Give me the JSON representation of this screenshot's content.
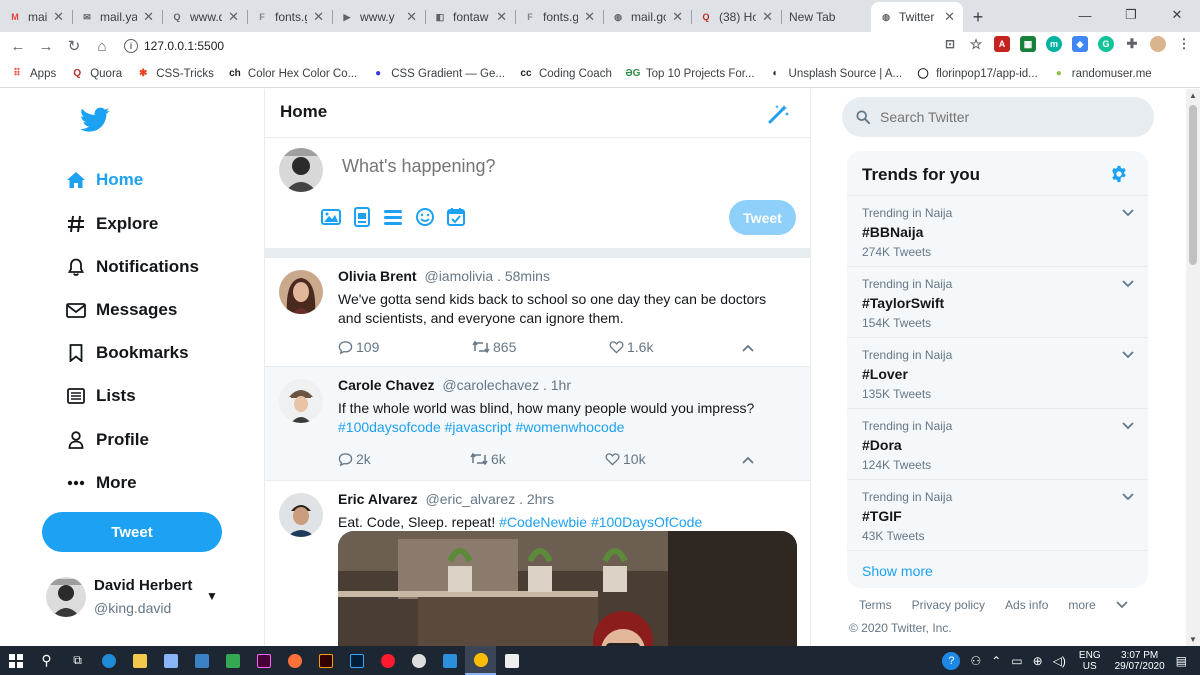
{
  "browser": {
    "tabs": [
      {
        "title": "mail.go",
        "icon": "gmail-icon",
        "color": "#ea4335",
        "glyph": "M"
      },
      {
        "title": "mail.ya",
        "icon": "mail-icon",
        "color": "#5f6368",
        "glyph": "✉"
      },
      {
        "title": "www.q",
        "icon": "quora-icon",
        "color": "#5f6368",
        "glyph": "Q"
      },
      {
        "title": "fonts.g",
        "icon": "fonts-icon",
        "color": "#80868b",
        "glyph": "F"
      },
      {
        "title": "www.y",
        "icon": "youtube-icon",
        "color": "#5f6368",
        "glyph": "▶"
      },
      {
        "title": "fontaw",
        "icon": "fontawesome-icon",
        "color": "#5f6368",
        "glyph": "◧"
      },
      {
        "title": "fonts.g",
        "icon": "fonts-icon",
        "color": "#80868b",
        "glyph": "F"
      },
      {
        "title": "mail.go",
        "icon": "globe-icon",
        "color": "#5f6368",
        "glyph": "◍"
      },
      {
        "title": "(38) Ho",
        "icon": "quora-icon",
        "color": "#b92b27",
        "glyph": "Q"
      },
      {
        "title": "New Tab",
        "icon": "",
        "color": "",
        "glyph": ""
      },
      {
        "title": "Twitter",
        "icon": "globe-icon",
        "color": "#5f6368",
        "glyph": "◍"
      }
    ],
    "active_tab": 10,
    "url": "127.0.0.1:5500",
    "bookmarks": [
      {
        "label": "Apps",
        "icon": "apps-icon",
        "color": "#ea4335",
        "glyph": "⠿"
      },
      {
        "label": "Quora",
        "icon": "quora-icon",
        "color": "#b92b27",
        "glyph": "Q"
      },
      {
        "label": "CSS-Tricks",
        "icon": "css-tricks-icon",
        "color": "#e8411b",
        "glyph": "✱"
      },
      {
        "label": "Color Hex Color Co...",
        "icon": "colorhex-icon",
        "color": "#202124",
        "glyph": "ch"
      },
      {
        "label": "CSS Gradient — Ge...",
        "icon": "css-gradient-icon",
        "color": "#3a3ae0",
        "glyph": "●"
      },
      {
        "label": "Coding Coach",
        "icon": "coding-coach-icon",
        "color": "#202124",
        "glyph": "cc"
      },
      {
        "label": "Top 10 Projects For...",
        "icon": "gfg-icon",
        "color": "#2f8d46",
        "glyph": "ƏG"
      },
      {
        "label": "Unsplash Source | A...",
        "icon": "unsplash-icon",
        "color": "#202124",
        "glyph": "◐"
      },
      {
        "label": "florinpop17/app-id...",
        "icon": "github-icon",
        "color": "#202124",
        "glyph": "◯"
      },
      {
        "label": "randomuser.me",
        "icon": "randomuser-icon",
        "color": "#8bc34a",
        "glyph": "●"
      }
    ]
  },
  "sidebar": {
    "items": [
      {
        "label": "Home",
        "icon": "home-icon",
        "active": true
      },
      {
        "label": "Explore",
        "icon": "hashtag-icon",
        "active": false
      },
      {
        "label": "Notifications",
        "icon": "bell-icon",
        "active": false
      },
      {
        "label": "Messages",
        "icon": "envelope-icon",
        "active": false
      },
      {
        "label": "Bookmarks",
        "icon": "bookmark-icon",
        "active": false
      },
      {
        "label": "Lists",
        "icon": "list-icon",
        "active": false
      },
      {
        "label": "Profile",
        "icon": "user-icon",
        "active": false
      },
      {
        "label": "More",
        "icon": "ellipsis-icon",
        "active": false
      }
    ],
    "tweet_button": "Tweet",
    "user": {
      "name": "David Herbert",
      "handle": "@king.david"
    }
  },
  "main": {
    "title": "Home",
    "compose": {
      "placeholder": "What's happening?",
      "tweet_button": "Tweet"
    },
    "posts": [
      {
        "name": "Olivia Brent",
        "handle": "@iamolivia",
        "time": ". 58mins",
        "text": "We've gotta send kids back to school so one day they can be doctors and scientists, and everyone can ignore them.",
        "tags": "",
        "replies": "109",
        "retweets": "865",
        "likes": "1.6k"
      },
      {
        "name": "Carole Chavez",
        "handle": "@carolechavez",
        "time": ". 1hr",
        "text": "If the whole world was blind, how many people would you impress?",
        "tags": "#100daysofcode #javascript #womenwhocode",
        "replies": "2k",
        "retweets": "6k",
        "likes": "10k"
      },
      {
        "name": "Eric Alvarez",
        "handle": "@eric_alvarez",
        "time": ". 2hrs",
        "text": "Eat. Code, Sleep. repeat!",
        "tags": "#CodeNewbie #100DaysOfCode"
      }
    ]
  },
  "right": {
    "search_placeholder": "Search Twitter",
    "trends_title": "Trends for you",
    "trends": [
      {
        "context": "Trending in Naija",
        "name": "#BBNaija",
        "count": "274K Tweets"
      },
      {
        "context": "Trending in Naija",
        "name": "#TaylorSwift",
        "count": "154K Tweets"
      },
      {
        "context": "Trending in Naija",
        "name": "#Lover",
        "count": "135K Tweets"
      },
      {
        "context": "Trending in Naija",
        "name": "#Dora",
        "count": "124K Tweets"
      },
      {
        "context": "Trending in Naija",
        "name": "#TGIF",
        "count": "43K Tweets"
      }
    ],
    "show_more": "Show more",
    "footer": [
      "Terms",
      "Privacy policy",
      "Ads info",
      "more"
    ],
    "copyright": "© 2020 Twitter, Inc."
  },
  "taskbar": {
    "lang": "ENG",
    "region": "US",
    "time": "3:07 PM",
    "date": "29/07/2020"
  },
  "colors": {
    "accent": "#1da1f2",
    "tweet_disabled": "#8ed0f9"
  }
}
